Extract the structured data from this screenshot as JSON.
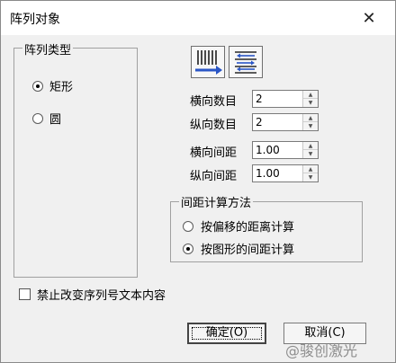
{
  "window": {
    "title": "阵列对象",
    "close_glyph": "✕"
  },
  "array_type": {
    "title": "阵列类型",
    "options": [
      {
        "label": "矩形",
        "checked": true
      },
      {
        "label": "圆",
        "checked": false
      }
    ]
  },
  "toolbar": {
    "left_icon": "columns-arrow-icon",
    "right_icon": "rows-arrows-icon"
  },
  "fields": {
    "h_count": {
      "label": "横向数目",
      "value": "2"
    },
    "v_count": {
      "label": "纵向数目",
      "value": "2"
    },
    "h_spacing": {
      "label": "横向间距",
      "value": "1.00"
    },
    "v_spacing": {
      "label": "纵向间距",
      "value": "1.00"
    }
  },
  "spacing_method": {
    "title": "间距计算方法",
    "options": [
      {
        "label": "按偏移的距离计算",
        "checked": false
      },
      {
        "label": "按图形的间距计算",
        "checked": true
      }
    ]
  },
  "no_change_checkbox": {
    "label": "禁止改变序列号文本内容",
    "checked": false
  },
  "buttons": {
    "ok": "确定(O)",
    "cancel": "取消(C)"
  },
  "watermark": "@骏创激光",
  "colors": {
    "accent_blue": "#2a56c6",
    "dialog_bg": "#f0f0f0"
  }
}
